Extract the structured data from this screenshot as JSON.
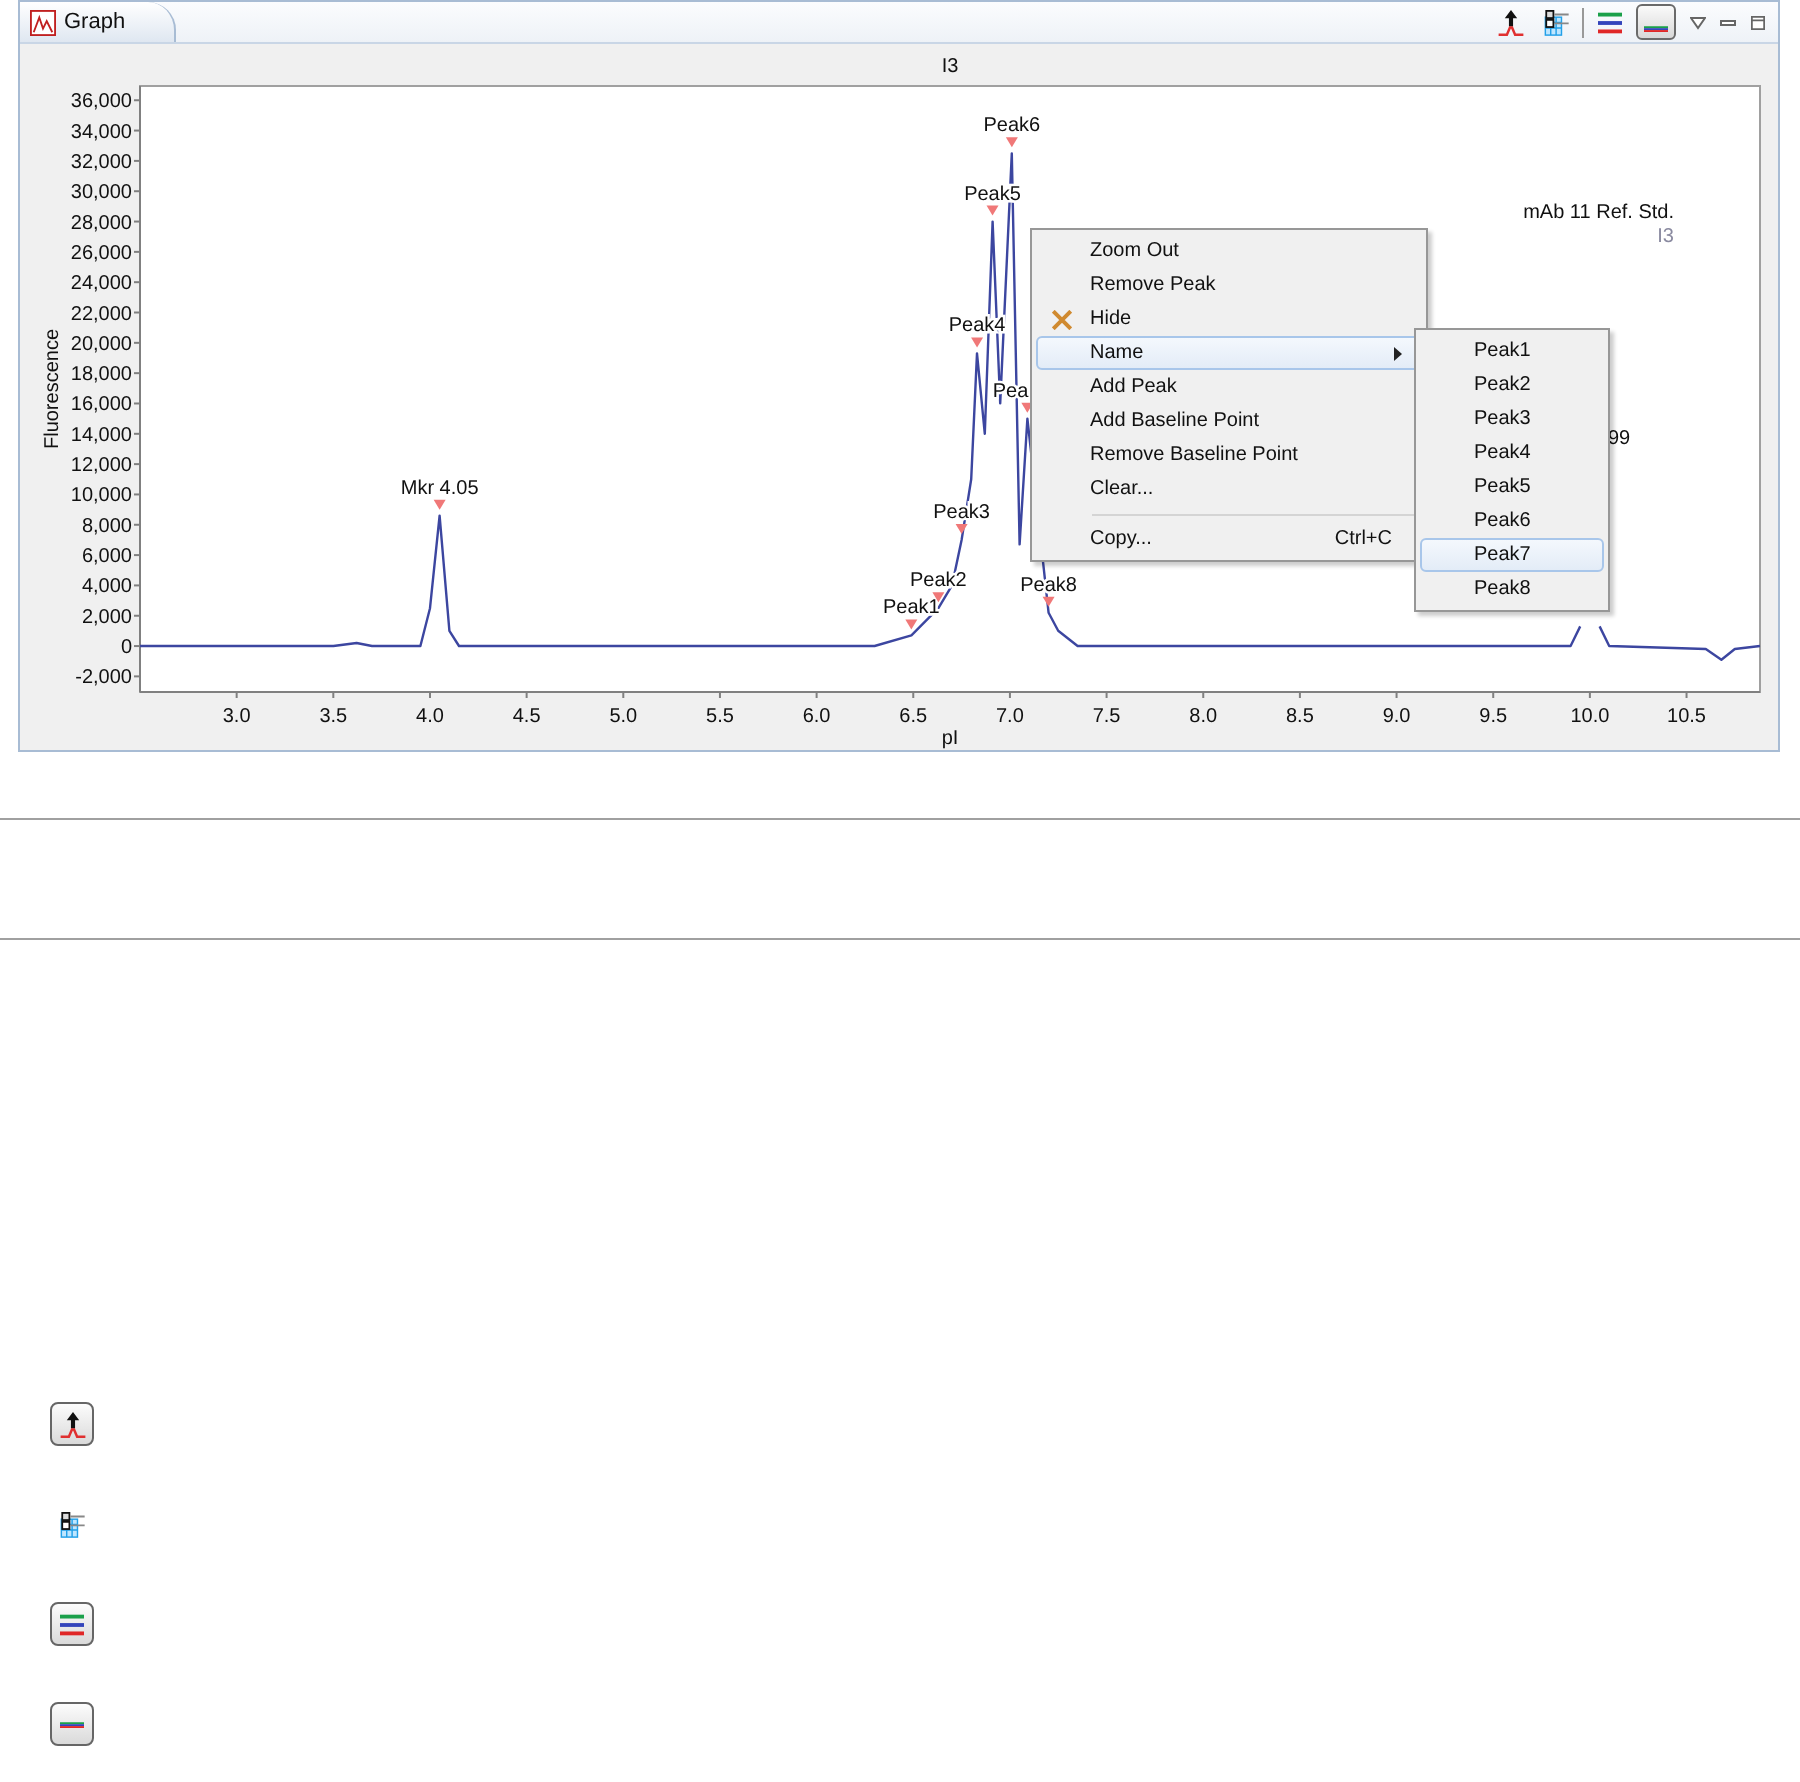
{
  "view": {
    "tab": {
      "label": "Graph",
      "selected": true
    },
    "toolbar": [
      {
        "kind": "peak",
        "selected": false
      },
      {
        "kind": "grid",
        "selected": false
      },
      {
        "kind": "lines",
        "selected": false
      },
      {
        "kind": "line",
        "selected": true
      }
    ]
  },
  "graph": {
    "chart_data": {
      "type": "line",
      "title": "I3",
      "xlabel": "pI",
      "ylabel": "Fluorescence",
      "xlim": [
        2.5,
        10.88
      ],
      "ylim": [
        -3030,
        36940
      ],
      "xticks": [
        {
          "value": 3,
          "label": "3.0"
        },
        {
          "value": 3.5,
          "label": "3.5"
        },
        {
          "value": 4,
          "label": "4.0"
        },
        {
          "value": 4.5,
          "label": "4.5"
        },
        {
          "value": 5,
          "label": "5.0"
        },
        {
          "value": 5.5,
          "label": "5.5"
        },
        {
          "value": 6,
          "label": "6.0"
        },
        {
          "value": 6.5,
          "label": "6.5"
        },
        {
          "value": 7,
          "label": "7.0"
        },
        {
          "value": 7.5,
          "label": "7.5"
        },
        {
          "value": 8,
          "label": "8.0"
        },
        {
          "value": 8.5,
          "label": "8.5"
        },
        {
          "value": 9,
          "label": "9.0"
        },
        {
          "value": 9.5,
          "label": "9.5"
        },
        {
          "value": 10,
          "label": "10.0"
        },
        {
          "value": 10.5,
          "label": "10.5"
        }
      ],
      "yticks": [
        {
          "value": -2000,
          "label": "-2,000"
        },
        {
          "value": 0,
          "label": "0"
        },
        {
          "value": 2000,
          "label": "2,000"
        },
        {
          "value": 4000,
          "label": "4,000"
        },
        {
          "value": 6000,
          "label": "6,000"
        },
        {
          "value": 8000,
          "label": "8,000"
        },
        {
          "value": 10000,
          "label": "10,000"
        },
        {
          "value": 12000,
          "label": "12,000"
        },
        {
          "value": 14000,
          "label": "14,000"
        },
        {
          "value": 16000,
          "label": "16,000"
        },
        {
          "value": 18000,
          "label": "18,000"
        },
        {
          "value": 20000,
          "label": "20,000"
        },
        {
          "value": 22000,
          "label": "22,000"
        },
        {
          "value": 24000,
          "label": "24,000"
        },
        {
          "value": 26000,
          "label": "26,000"
        },
        {
          "value": 28000,
          "label": "28,000"
        },
        {
          "value": 30000,
          "label": "30,000"
        },
        {
          "value": 32000,
          "label": "32,000"
        },
        {
          "value": 34000,
          "label": "34,000"
        },
        {
          "value": 36000,
          "label": "36,000"
        }
      ],
      "x": [
        2.5,
        3.5,
        3.62,
        3.7,
        3.95,
        4.0,
        4.05,
        4.1,
        4.15,
        6.3,
        6.49,
        6.63,
        6.7,
        6.75,
        6.8,
        6.83,
        6.87,
        6.91,
        6.95,
        7.01,
        7.05,
        7.09,
        7.2,
        7.25,
        7.35,
        9.9,
        9.95,
        10.0,
        10.05,
        10.1,
        10.6,
        10.68,
        10.75,
        10.88
      ],
      "series": [
        {
          "name": "mAb 11 Ref. Std.",
          "color": "#3c46a0",
          "values": [
            0,
            0,
            200,
            0,
            0,
            2500,
            8600,
            1000,
            0,
            0,
            700,
            2500,
            4000,
            7000,
            11000,
            19300,
            14000,
            28000,
            16000,
            32500,
            6700,
            15000,
            2200,
            1000,
            0,
            0,
            1300,
            null,
            1300,
            0,
            -200,
            -900,
            -200,
            0
          ]
        }
      ],
      "annotations": [
        {
          "x": 4.05,
          "y": 8600,
          "text": "Mkr 4.05"
        },
        {
          "x": 6.49,
          "y": 700,
          "text": "Peak1"
        },
        {
          "x": 6.63,
          "y": 2500,
          "text": "Peak2"
        },
        {
          "x": 6.75,
          "y": 7000,
          "text": "Peak3"
        },
        {
          "x": 6.83,
          "y": 19300,
          "text": "Peak4"
        },
        {
          "x": 6.91,
          "y": 28000,
          "text": "Peak5"
        },
        {
          "x": 7.01,
          "y": 32500,
          "text": "Peak6"
        },
        {
          "x": 7.09,
          "y": 15000,
          "text": "Pea"
        },
        {
          "x": 7.2,
          "y": 2200,
          "text": "Peak8"
        }
      ]
    },
    "partial_label": "99",
    "legend": {
      "sample": "I3"
    }
  },
  "context_menu": [
    {
      "kind": "plain",
      "label": "Zoom Out",
      "selected": false
    },
    {
      "kind": "plain",
      "label": "Remove  Peak",
      "selected": false
    },
    {
      "kind": "marked",
      "label": "Hide",
      "selected": false
    },
    {
      "kind": "submenu",
      "label": "Name",
      "selected": true
    },
    {
      "kind": "plain",
      "label": "Add Peak",
      "selected": false
    },
    {
      "kind": "plain",
      "label": "Add Baseline Point",
      "selected": false
    },
    {
      "kind": "plain",
      "label": "Remove Baseline Point",
      "selected": false
    },
    {
      "kind": "plain",
      "label": "Clear...",
      "selected": false
    },
    {
      "kind": "separator"
    },
    {
      "kind": "plain",
      "label": "Copy...",
      "shortcut": "Ctrl+C",
      "selected": false
    }
  ],
  "submenu": [
    {
      "label": "Peak1",
      "selected": false
    },
    {
      "label": "Peak2",
      "selected": false
    },
    {
      "label": "Peak3",
      "selected": false
    },
    {
      "label": "Peak4",
      "selected": false
    },
    {
      "label": "Peak5",
      "selected": false
    },
    {
      "label": "Peak6",
      "selected": false
    },
    {
      "label": "Peak7",
      "selected": true
    },
    {
      "label": "Peak8",
      "selected": false
    }
  ],
  "icon_legend": [
    {
      "kind": "peak"
    },
    {
      "kind": "grid"
    },
    {
      "kind": "lines"
    },
    {
      "kind": "line"
    }
  ]
}
